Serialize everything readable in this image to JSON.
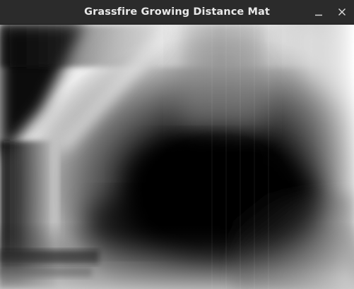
{
  "window": {
    "title": "Grassfire Growing Distance Mat",
    "controls": {
      "minimize": "minimize-icon",
      "close": "close-icon"
    },
    "colors": {
      "titlebar": "#2b2b2b",
      "title_text": "#e8e8e8",
      "image_dark": "#000000",
      "image_light": "#ffffff"
    }
  }
}
